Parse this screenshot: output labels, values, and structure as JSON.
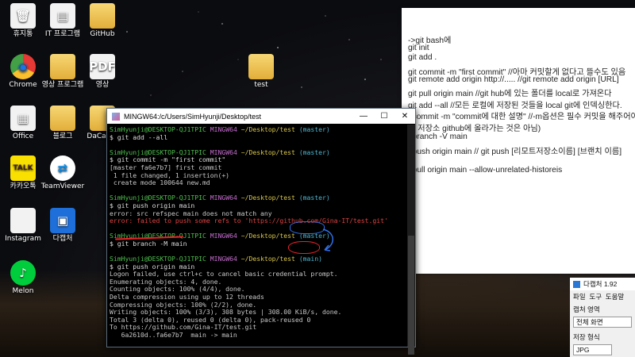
{
  "desktop": {
    "icons": [
      {
        "label": "휴지통",
        "glyph": "🗑",
        "kind": "doc"
      },
      {
        "label": "IT 프로그램",
        "glyph": "▤",
        "kind": "doc"
      },
      {
        "label": "GitHub",
        "glyph": "",
        "kind": "folder"
      },
      {
        "label": "Chrome",
        "glyph": "◉",
        "kind": "chrome"
      },
      {
        "label": "영상 프로그램",
        "glyph": "",
        "kind": "folder"
      },
      {
        "label": "영상",
        "glyph": "PDF",
        "kind": "doc"
      },
      {
        "label": "test",
        "glyph": "",
        "kind": "folder"
      },
      {
        "label": "Office",
        "glyph": "▦",
        "kind": "doc"
      },
      {
        "label": "블로그",
        "glyph": "",
        "kind": "folder"
      },
      {
        "label": "DaCaptu",
        "glyph": "",
        "kind": "folder"
      },
      {
        "label": "카카오톡",
        "glyph": "TALK",
        "kind": "kakao"
      },
      {
        "label": "TeamViewer",
        "glyph": "⇄",
        "kind": "teamviewer"
      },
      {
        "label": "Instagram",
        "glyph": "",
        "kind": "doc"
      },
      {
        "label": "다캡처",
        "glyph": "▣",
        "kind": "dacapture"
      },
      {
        "label": "Melon",
        "glyph": "♪",
        "kind": "melon"
      }
    ]
  },
  "note": {
    "lines": [
      "->git bash에",
      "git init",
      "git add .",
      "git commit -m \"first commit\" //아마 커밋할게 없다고 뜰수도 있음",
      "git remote add origin http://.....   //git remote add origin [URL]",
      "git pull origin main //git hub에 있는 폴더를 local로 가져온다",
      "git add --all //모든 로컬에 저장된 것들을 local git에 인덱싱한다.",
      "t commit -m \"commit에 대한 설명\" //-m옵션은 필수 커밋을 해주어야",
      "격 저장소 github에 올라가는 것은 아님)",
      "t branch -V main",
      "t push origin main // git push [리모트저장소이름] [브랜치 이름]",
      "t pull origin main --allow-unrelated-historeis"
    ]
  },
  "terminal": {
    "title": "MINGW64:/c/Users/SimHyunji/Desktop/test",
    "user": "SimHyunji@DESKTOP-QJ1TPIC",
    "env": "MINGW64",
    "path": "~/Desktop/test",
    "branch_master": "(master)",
    "branch_main": "(main)",
    "cmd_add": "$ git add --all",
    "cmd_commit": "$ git commit -m \"first commit\"",
    "out_commit_1": "[master fa6e7b7] first commit",
    "out_commit_2": " 1 file changed, 1 insertion(+)",
    "out_commit_3": " create mode 100644 new.md",
    "cmd_push1": "$ git push origin main",
    "err_1": "error: src refspec main does not match any",
    "err_2": "error: failed to push some refs to 'https://github.com/Gina-IT/test.git'",
    "cmd_branch": "$ git branch -M main",
    "cmd_push2": "$ git push origin main",
    "out_push": [
      "Logon failed, use ctrl+c to cancel basic credential prompt.",
      "Enumerating objects: 4, done.",
      "Counting objects: 100% (4/4), done.",
      "Delta compression using up to 12 threads",
      "Compressing objects: 100% (2/2), done.",
      "Writing objects: 100% (3/3), 308 bytes | 308.00 KiB/s, done.",
      "Total 3 (delta 0), reused 0 (delta 0), pack-reused 0",
      "To https://github.com/Gina-IT/test.git",
      "   6a2610d..fa6e7b7  main -> main"
    ],
    "prompt_last": "$ |"
  },
  "capture_app": {
    "title": "다캡처 1.92",
    "menu": [
      "파일",
      "도구",
      "도움말"
    ],
    "capture_area_label": "캡처 영역",
    "capture_area_value": "전체 화면",
    "save_format_label": "저장 형식",
    "save_format_value": "JPG"
  },
  "colors": {
    "prompt_user": "#4ec14e",
    "prompt_env": "#c76dd1",
    "prompt_path": "#d9c64b",
    "prompt_branch": "#4fb6d1",
    "error": "#e04343",
    "annotation_red": "#e8242a",
    "annotation_blue": "#2f6fe8"
  }
}
